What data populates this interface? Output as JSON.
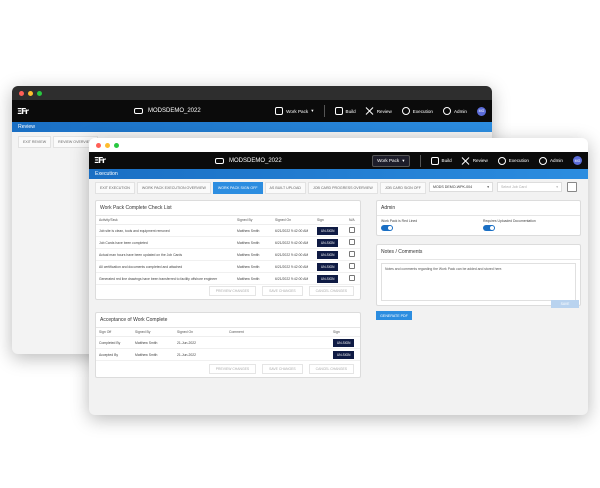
{
  "back_window": {
    "title": "MODSDEMO_2022",
    "section": "Review",
    "nav": {
      "workpack": "Work Pack",
      "build": "Build",
      "review": "Review",
      "execution": "Execution",
      "admin": "Admin",
      "avatar": "MG"
    },
    "tabs": [
      "EXIT REVIEW",
      "REVIEW OVERVIEW"
    ]
  },
  "front_window": {
    "title": "MODSDEMO_2022",
    "section": "Execution",
    "nav": {
      "workpack": "Work Pack",
      "build": "Build",
      "review": "Review",
      "execution": "Execution",
      "admin": "Admin",
      "avatar": "MG"
    },
    "tabs": [
      {
        "label": "EXIT EXECUTION",
        "active": false
      },
      {
        "label": "WORK PACK EXECUTION OVERVIEW",
        "active": false
      },
      {
        "label": "WORK PACK SIGN OFF",
        "active": true
      },
      {
        "label": "AS BUILT UPLOAD",
        "active": false
      },
      {
        "label": "JOB CARD PROGRESS OVERVIEW",
        "active": false
      },
      {
        "label": "JOB CARD SIGN OFF",
        "active": false
      }
    ],
    "wp_select": "MODS DEMO-WPK-004",
    "job_card_placeholder": "Select Job Card",
    "checklist": {
      "title": "Work Pack Complete Check List",
      "headers": [
        "Activity/Task",
        "Signed By",
        "Signed On",
        "Sign",
        "N/A"
      ],
      "rows": [
        {
          "task": "Job site is clean, tools and equipment removed",
          "by": "Matthew Smith",
          "on": "6/21/2022 9:42:00 AM",
          "sign": "UN-SIGN"
        },
        {
          "task": "Job Cards have been completed",
          "by": "Matthew Smith",
          "on": "6/21/2022 9:42:00 AM",
          "sign": "UN-SIGN"
        },
        {
          "task": "Actual man hours have been updated on the Job Cards",
          "by": "Matthew Smith",
          "on": "6/21/2022 9:42:00 AM",
          "sign": "UN-SIGN"
        },
        {
          "task": "All certification and documents completed and attached",
          "by": "Matthew Smith",
          "on": "6/21/2022 9:42:00 AM",
          "sign": "UN-SIGN"
        },
        {
          "task": "Generated red line drawings have been transferred to facility offshore engineer",
          "by": "Matthew Smith",
          "on": "6/21/2022 9:42:00 AM",
          "sign": "UN-SIGN"
        }
      ],
      "buttons": [
        "PREVIEW CHANGES",
        "SAVE CHANGES",
        "CANCEL CHANGES"
      ]
    },
    "acceptance": {
      "title": "Acceptance of Work Complete",
      "headers": [
        "Sign Off",
        "Signed By",
        "Signed On",
        "Comment",
        "Sign"
      ],
      "rows": [
        {
          "role": "Completed By",
          "by": "Matthew Smith",
          "on": "21-Jun-2022",
          "sign": "UN-SIGN"
        },
        {
          "role": "Accepted By",
          "by": "Matthew Smith",
          "on": "21-Jun-2022",
          "sign": "UN-SIGN"
        }
      ],
      "buttons": [
        "PREVIEW CHANGES",
        "SAVE CHANGES",
        "CANCEL CHANGES"
      ]
    },
    "admin": {
      "title": "Admin",
      "toggle1_label": "Work Pack is Red Lined",
      "toggle2_label": "Requires Uploaded Documentation"
    },
    "notes": {
      "title": "Notes / Comments",
      "text": "Notes and comments regarding the Work Pack can be added and stored here.",
      "save": "SAVE"
    },
    "generate_pdf": "GENERATE PDF"
  }
}
